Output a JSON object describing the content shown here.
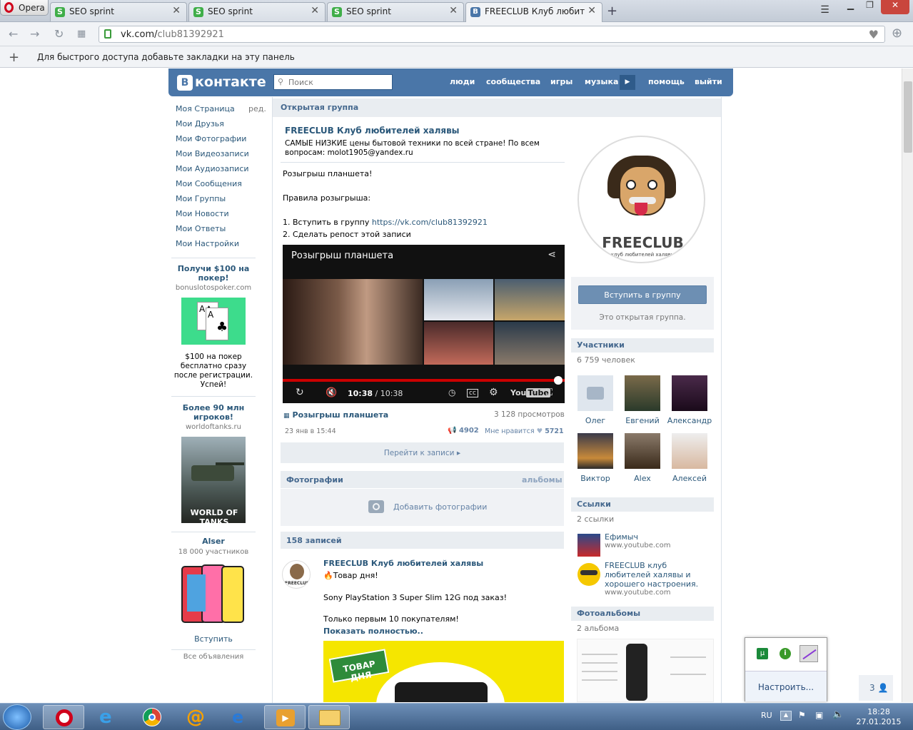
{
  "browser": {
    "menu_label": "Opera",
    "tabs": [
      {
        "title": "SEO sprint",
        "icon": "seosprint-favicon"
      },
      {
        "title": "SEO sprint",
        "icon": "seosprint-favicon"
      },
      {
        "title": "SEO sprint",
        "icon": "seosprint-favicon"
      },
      {
        "title": "FREECLUB Клуб любителе",
        "icon": "vk-favicon"
      }
    ],
    "new_tab": "+",
    "url_domain": "vk.com/",
    "url_path": "club81392921",
    "bookmarks_hint": "Для быстрого доступа добавьте закладки на эту панель"
  },
  "vk": {
    "logo": "контакте",
    "logo_letter": "В",
    "search_placeholder": "Поиск",
    "nav": [
      "люди",
      "сообщества",
      "игры",
      "музыка",
      "помощь",
      "выйти"
    ],
    "left_menu": [
      "Моя Страница",
      "Мои Друзья",
      "Мои Фотографии",
      "Мои Видеозаписи",
      "Мои Аудиозаписи",
      "Мои Сообщения",
      "Мои Группы",
      "Мои Новости",
      "Мои Ответы",
      "Мои Настройки"
    ],
    "edit_label": "ред.",
    "ads": [
      {
        "title": "Получи $100 на покер!",
        "site": "bonuslotospoker.com",
        "desc": "$100 на покер бесплатно сразу после регистрации. Успей!"
      },
      {
        "title": "Более 90 млн игроков!",
        "site": "worldoftanks.ru",
        "logo": "WORLD OF TANKS"
      },
      {
        "title": "Alser",
        "site": "18 000 участников",
        "action": "Вступить"
      }
    ],
    "all_ads": "Все объявления"
  },
  "group": {
    "type_label": "Открытая группа",
    "name": "FREECLUB Клуб любителей халявы",
    "status": "САМЫЕ НИЗКИЕ цены бытовой техники по всей стране! По всем вопросам: molot1905@yandex.ru",
    "post_lines": [
      "Розыгрыш планшета!",
      "Правила розыгрыша:",
      "1. Вступить в группу ",
      "2. Сделать репост этой записи"
    ],
    "post_link": "https://vk.com/club81392921",
    "video": {
      "title": "Розыгрыш планшета",
      "time_current": "10:38",
      "time_total": "/ 10:38",
      "progress": 1.0
    },
    "video_caption": "Розыгрыш планшета",
    "views": "3 128 просмотров",
    "date": "23 янв в 15:44",
    "reposts": "4902",
    "likes_label": "Мне нравится",
    "likes": "5721",
    "goto_post": "Перейти к записи",
    "photos_header": "Фотографии",
    "albums_link": "альбомы",
    "add_photos": "Добавить фотографии",
    "wall_header": "158 записей",
    "wall_post": {
      "author": "FREECLUB Клуб любителей халявы",
      "line1": "Товар дня!",
      "line2": "Sony PlayStation 3 Super Slim 12G под заказ!",
      "line3": "Только первым 10 покупателям!",
      "show_more": "Показать полностью..",
      "banner": "ТОВАР ДНЯ"
    },
    "avatar_text": "FREECLUB",
    "avatar_sub": "клуб любителей халявы",
    "join_button": "Вступить в группу",
    "open_note": "Это открытая группа.",
    "members_header": "Участники",
    "members_count": "6 759 человек",
    "members": [
      "Олег",
      "Евгений",
      "Александр",
      "Виктор",
      "Alex",
      "Алексей"
    ],
    "links_header": "Ссылки",
    "links_count": "2 ссылки",
    "links": [
      {
        "title": "Ефимыч",
        "url": "www.youtube.com"
      },
      {
        "title": "FREECLUB клуб любителей халявы и хорошего настроения.",
        "url": "www.youtube.com"
      }
    ],
    "albums_header": "Фотоальбомы",
    "albums_count": "2 альбома"
  },
  "popup": {
    "configure": "Настроить..."
  },
  "counter": "3",
  "taskbar": {
    "lang": "RU",
    "time": "18:28",
    "date": "27.01.2015"
  }
}
